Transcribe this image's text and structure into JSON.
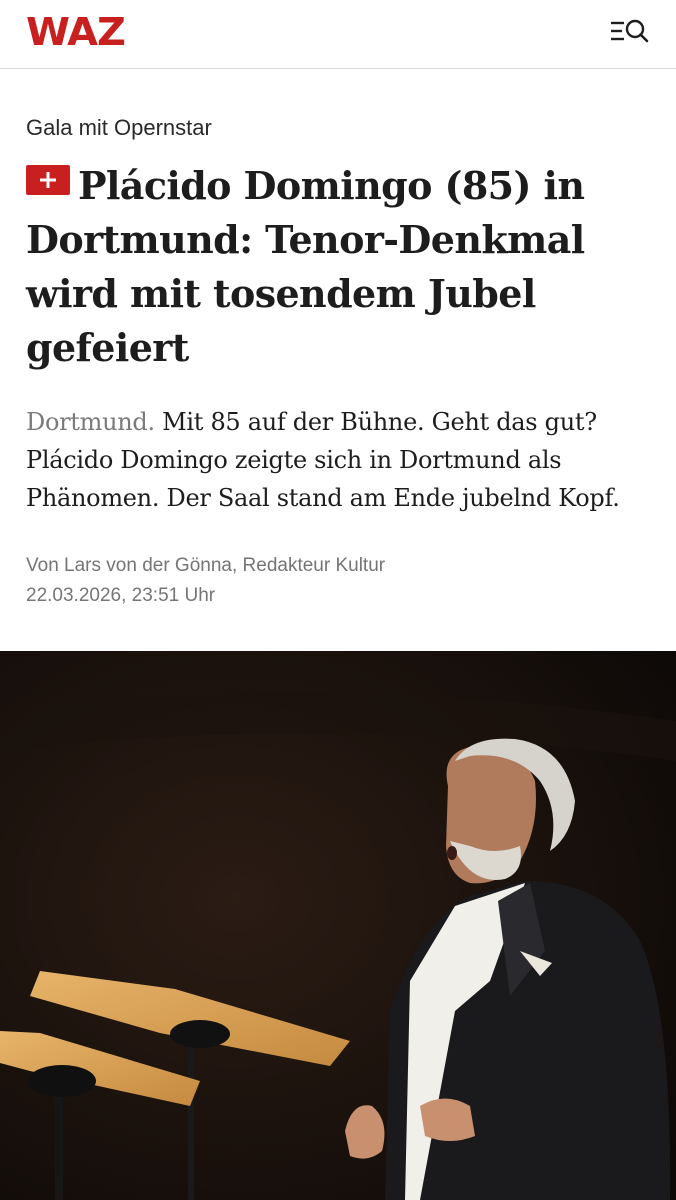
{
  "header": {
    "logo_text": "WAZ",
    "logo_color": "#c8201f",
    "menu_icon": "menu-search-icon"
  },
  "article": {
    "kicker": "Gala mit Opernstar",
    "badge_icon": "plus-icon",
    "headline": "Plácido Domingo (85) in Dortmund: Tenor-Denkmal wird mit tosendem Jubel gefeiert",
    "teaser_place": "Dortmund.",
    "teaser_text": "Mit 85 auf der Bühne. Geht das gut? Plácido Domingo zeigte sich in Dortmund als Phänomen. Der Saal stand am Ende jubelnd Kopf.",
    "author_line": "Von Lars von der Gönna, Redakteur Kultur",
    "date_line": "22.03.2026, 23:51 Uhr"
  },
  "colors": {
    "accent": "#c8201f",
    "text": "#1d1d1d",
    "muted": "#757575"
  }
}
